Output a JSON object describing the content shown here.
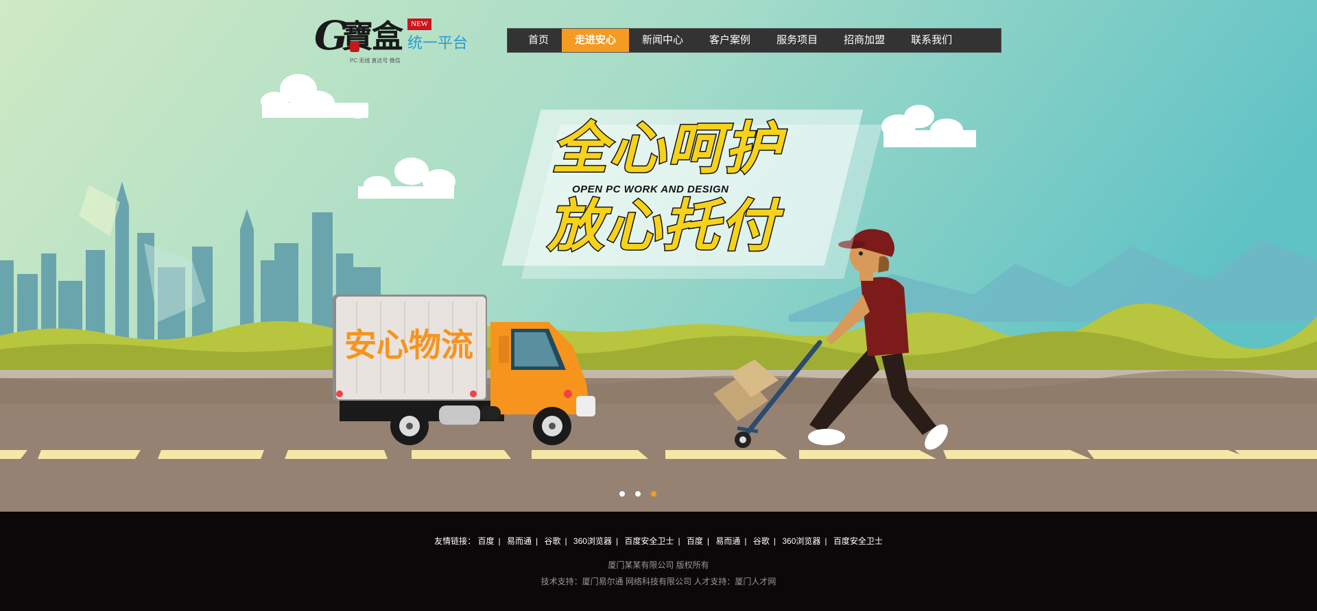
{
  "logo": {
    "letter": "G",
    "mark": "寶盒",
    "badge": "NEW",
    "tagline": "统一平台",
    "subtitle": "PC 无线 直达号 微信"
  },
  "nav": {
    "items": [
      {
        "label": "首页",
        "active": false
      },
      {
        "label": "走进安心",
        "active": true
      },
      {
        "label": "新闻中心",
        "active": false
      },
      {
        "label": "客户案例",
        "active": false
      },
      {
        "label": "服务项目",
        "active": false
      },
      {
        "label": "招商加盟",
        "active": false
      },
      {
        "label": "联系我们",
        "active": false
      }
    ]
  },
  "banner": {
    "headline1": "全心呵护",
    "english": "OPEN PC WORK AND DESIGN",
    "headline2": "放心托付",
    "truck_label": "安心物流"
  },
  "slider": {
    "count": 3,
    "active_index": 2
  },
  "footer": {
    "links_label": "友情链接：",
    "links": [
      "百度",
      "易而通",
      "谷歌",
      "360浏览器",
      "百度安全卫士",
      "百度",
      "易而通",
      "谷歌",
      "360浏览器",
      "百度安全卫士"
    ],
    "copyright": "厦门某某有限公司  版权所有",
    "support": "技术支持：厦门易尔通 网络科技有限公司 人才支持：厦门人才网"
  },
  "colors": {
    "accent": "#f59a23",
    "nav_bg": "#333333",
    "footer_bg": "#0c0708",
    "headline_yellow": "#f7d21a",
    "truck_orange": "#f7941d"
  }
}
